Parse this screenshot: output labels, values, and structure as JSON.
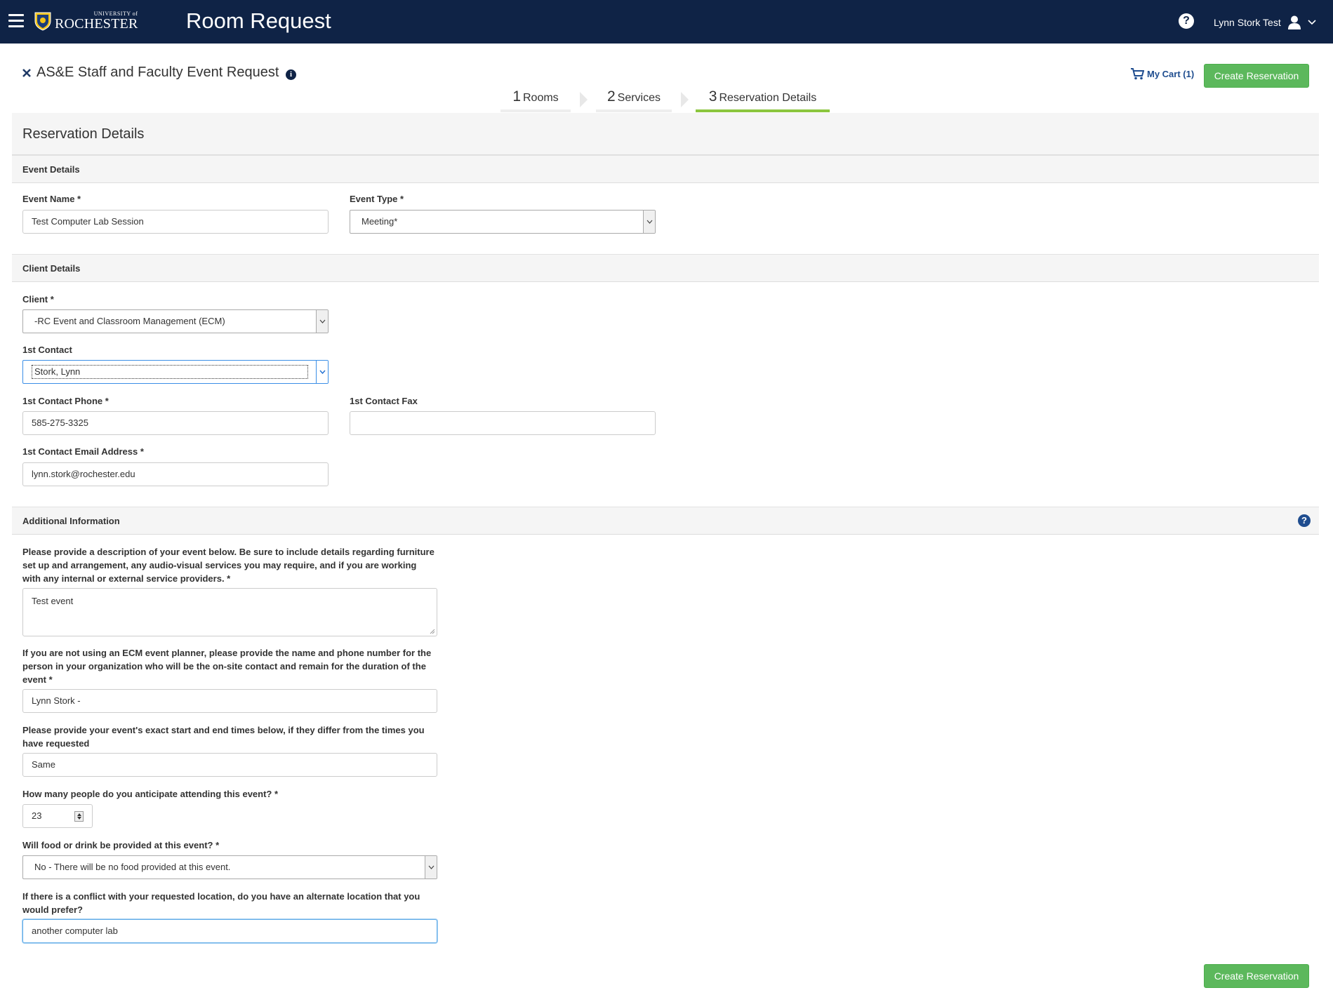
{
  "topbar": {
    "logo_small": "UNIVERSITY of",
    "logo_main": "ROCHESTER",
    "app_title": "Room Request",
    "user_name": "Lynn Stork Test",
    "help_glyph": "?"
  },
  "header": {
    "page_title": "AS&E Staff and Faculty Event Request",
    "info_glyph": "i",
    "cart_label": "My Cart (1)",
    "create_button": "Create Reservation"
  },
  "steps": [
    {
      "num": "1",
      "label": "Rooms",
      "active": false
    },
    {
      "num": "2",
      "label": "Services",
      "active": false
    },
    {
      "num": "3",
      "label": "Reservation Details",
      "active": true
    }
  ],
  "section_title": "Reservation Details",
  "event_details": {
    "title": "Event Details",
    "event_name_label": "Event Name *",
    "event_name_value": "Test Computer Lab Session",
    "event_type_label": "Event Type *",
    "event_type_value": "Meeting*"
  },
  "client_details": {
    "title": "Client Details",
    "client_label": "Client *",
    "client_value": "-RC Event and Classroom Management (ECM)",
    "contact_label": "1st Contact",
    "contact_value": "Stork, Lynn",
    "phone_label": "1st Contact Phone *",
    "phone_value": "585-275-3325",
    "fax_label": "1st Contact Fax",
    "fax_value": "",
    "email_label": "1st Contact Email Address *",
    "email_value": "lynn.stork@rochester.edu"
  },
  "additional_info": {
    "title": "Additional Information",
    "help_glyph": "?",
    "q1_label": "Please provide a description of your event below. Be sure to include details regarding furniture set up and arrangement, any audio-visual services you may require, and if you are working with any internal or external service providers. *",
    "q1_value": "Test event",
    "q2_label": "If you are not using an ECM event planner, please provide the name and phone number for the person in your organization who will be the on-site contact and remain for the duration of the event *",
    "q2_value": "Lynn Stork -",
    "q3_label": "Please provide your event's exact start and end times below, if they differ from the times you have requested",
    "q3_value": "Same",
    "q4_label": "How many people do you anticipate attending this event? *",
    "q4_value": "23",
    "q5_label": "Will food or drink be provided at this event? *",
    "q5_value": "No - There will be no food provided at this event.",
    "q6_label": "If there is a conflict with your requested location, do you have an alternate location that you would prefer?",
    "q6_value": "another computer lab"
  },
  "footer": {
    "create_button": "Create Reservation"
  },
  "colors": {
    "topbar": "#0f2346",
    "accent_green": "#5cb85c",
    "step_active": "#8cc63f",
    "link_blue": "#1f4d8f"
  },
  "icons": [
    "hamburger-icon",
    "university-seal-icon",
    "help-icon",
    "user-icon",
    "chevron-down-icon",
    "close-icon",
    "info-icon",
    "cart-icon"
  ]
}
